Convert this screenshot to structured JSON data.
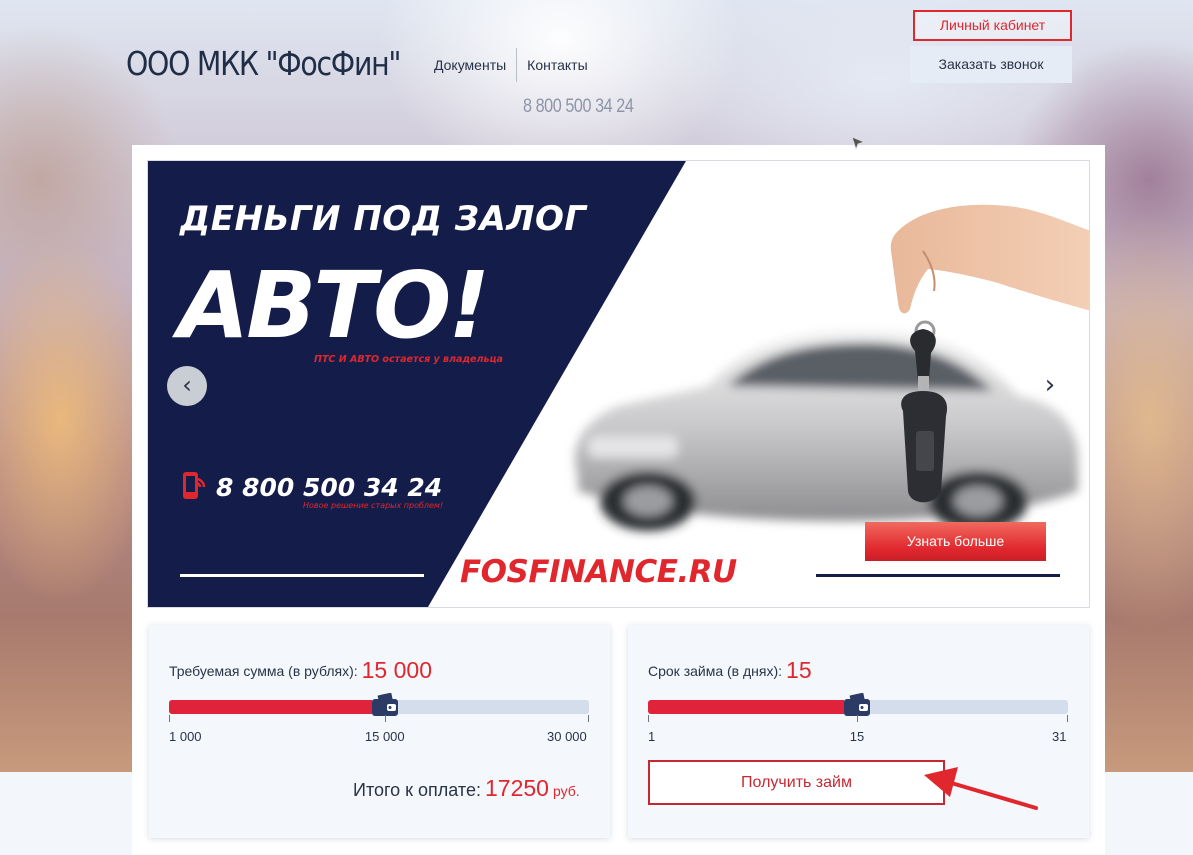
{
  "header": {
    "logo": "ООО МКК \"ФосФин\"",
    "nav": [
      {
        "label": "Документы"
      },
      {
        "label": "Контакты"
      }
    ],
    "phone": "8 800 500 34 24",
    "cabinet_label": "Личный кабинет",
    "callback_label": "Заказать звонок"
  },
  "slide": {
    "headline": "ДЕНЬГИ ПОД ЗАЛОГ",
    "big": "АВТО!",
    "subline": "ПТС И  АВТО остается у владельца",
    "phone": "8 800 500 34 24",
    "phone_sub": "Новое решение старых проблем!",
    "site": "FOSFINANCE.RU",
    "learn_more": "Узнать больше",
    "prev_icon": "chevron-left-icon",
    "next_icon": "chevron-right-icon"
  },
  "calc_amount": {
    "label": "Требуемая сумма (в рублях):",
    "value": "15 000",
    "min_label": "1 000",
    "mid_label": "15 000",
    "max_label": "30 000",
    "min": 1000,
    "max": 30000,
    "current": 15000,
    "total_label": "Итого к оплате:",
    "total_value": "17250",
    "total_currency": "руб."
  },
  "calc_term": {
    "label": "Срок займа (в днях):",
    "value": "15",
    "min_label": "1",
    "mid_label": "15",
    "max_label": "31",
    "min": 1,
    "max": 31,
    "current": 15,
    "get_loan_label": "Получить займ"
  },
  "colors": {
    "accent": "#e0272e",
    "navy": "#141d49",
    "slider_fill": "#e0233a",
    "slider_track": "#d4ddeb"
  }
}
